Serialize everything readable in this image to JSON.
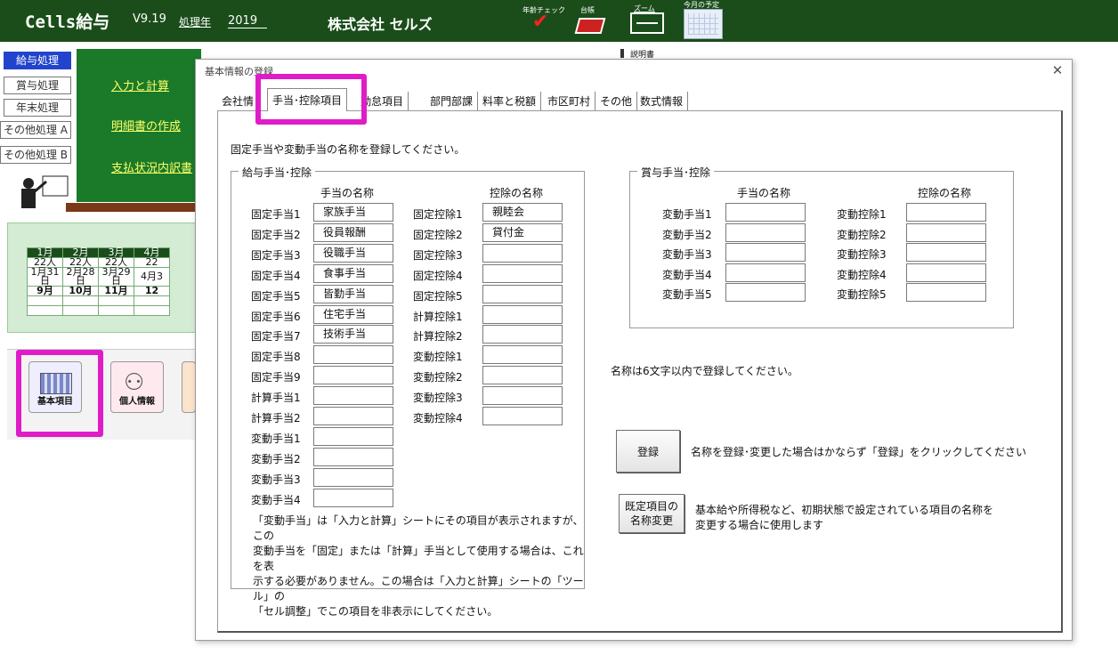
{
  "header": {
    "app_title": "Cells給与",
    "version": "V9.19",
    "year_label": "処理年",
    "year": "2019",
    "company": "株式会社 セルズ",
    "icons": [
      {
        "name": "age-check",
        "label": "年齢チェック"
      },
      {
        "name": "ledger",
        "label": "台帳"
      },
      {
        "name": "zoom",
        "label": "ズーム"
      },
      {
        "name": "monthly-schedule",
        "label": "今月の予定"
      }
    ],
    "manual_label": "説明書"
  },
  "sidebar": {
    "buttons": [
      "給与処理",
      "賞与処理",
      "年末処理",
      "その他処理 A",
      "その他処理 B"
    ],
    "links": [
      "入力と計算",
      "明細書の作成",
      "支払状況内訳書"
    ],
    "calendar": {
      "months": [
        "1月",
        "2月",
        "3月",
        "4月"
      ],
      "counts": [
        "22人",
        "22人",
        "22人",
        "22"
      ],
      "dates": [
        "1月31日",
        "2月28日",
        "3月29日",
        "4月3"
      ],
      "months2": [
        "9月",
        "10月",
        "11月",
        "12"
      ]
    },
    "icon_buttons": [
      {
        "name": "basic-items",
        "label": "基本項目"
      },
      {
        "name": "personal-info",
        "label": "個人情報"
      }
    ]
  },
  "dialog": {
    "title": "基本情報の登録",
    "tabs": [
      "会社情",
      "手当･控除項目",
      "勤怠項目",
      "部門部課",
      "料率と税額",
      "市区町村",
      "その他",
      "数式情報"
    ],
    "instruction": "固定手当や変動手当の名称を登録してください。",
    "salary_group": {
      "legend": "給与手当･控除",
      "allowance_header": "手当の名称",
      "deduction_header": "控除の名称",
      "allowances": [
        {
          "label": "固定手当1",
          "value": "家族手当"
        },
        {
          "label": "固定手当2",
          "value": "役員報酬"
        },
        {
          "label": "固定手当3",
          "value": "役職手当"
        },
        {
          "label": "固定手当4",
          "value": "食事手当"
        },
        {
          "label": "固定手当5",
          "value": "皆勤手当"
        },
        {
          "label": "固定手当6",
          "value": "住宅手当"
        },
        {
          "label": "固定手当7",
          "value": "技術手当"
        },
        {
          "label": "固定手当8",
          "value": ""
        },
        {
          "label": "固定手当9",
          "value": ""
        },
        {
          "label": "計算手当1",
          "value": ""
        },
        {
          "label": "計算手当2",
          "value": ""
        },
        {
          "label": "変動手当1",
          "value": ""
        },
        {
          "label": "変動手当2",
          "value": ""
        },
        {
          "label": "変動手当3",
          "value": ""
        },
        {
          "label": "変動手当4",
          "value": ""
        }
      ],
      "deductions": [
        {
          "label": "固定控除1",
          "value": "親睦会"
        },
        {
          "label": "固定控除2",
          "value": "貸付金"
        },
        {
          "label": "固定控除3",
          "value": ""
        },
        {
          "label": "固定控除4",
          "value": ""
        },
        {
          "label": "固定控除5",
          "value": ""
        },
        {
          "label": "計算控除1",
          "value": ""
        },
        {
          "label": "計算控除2",
          "value": ""
        },
        {
          "label": "変動控除1",
          "value": ""
        },
        {
          "label": "変動控除2",
          "value": ""
        },
        {
          "label": "変動控除3",
          "value": ""
        },
        {
          "label": "変動控除4",
          "value": ""
        }
      ],
      "note": "「変動手当」は「入力と計算」シートにその項目が表示されますが、この\n変動手当を「固定」または「計算」手当として使用する場合は、これを表\n示する必要がありません。この場合は「入力と計算」シートの「ツール」の\n「セル調整」でこの項目を非表示にしてください。"
    },
    "bonus_group": {
      "legend": "賞与手当･控除",
      "allowance_header": "手当の名称",
      "deduction_header": "控除の名称",
      "allowances": [
        {
          "label": "変動手当1",
          "value": ""
        },
        {
          "label": "変動手当2",
          "value": ""
        },
        {
          "label": "変動手当3",
          "value": ""
        },
        {
          "label": "変動手当4",
          "value": ""
        },
        {
          "label": "変動手当5",
          "value": ""
        }
      ],
      "deductions": [
        {
          "label": "変動控除1",
          "value": ""
        },
        {
          "label": "変動控除2",
          "value": ""
        },
        {
          "label": "変動控除3",
          "value": ""
        },
        {
          "label": "変動控除4",
          "value": ""
        },
        {
          "label": "変動控除5",
          "value": ""
        }
      ]
    },
    "length_note": "名称は6文字以内で登録してください。",
    "register_button": "登録",
    "register_note": "名称を登録･変更した場合はかならず「登録」をクリックしてください",
    "rename_button": "既定項目の\n名称変更",
    "rename_note": "基本給や所得税など、初期状態で設定されている項目の名称を\n変更する場合に使用します"
  }
}
